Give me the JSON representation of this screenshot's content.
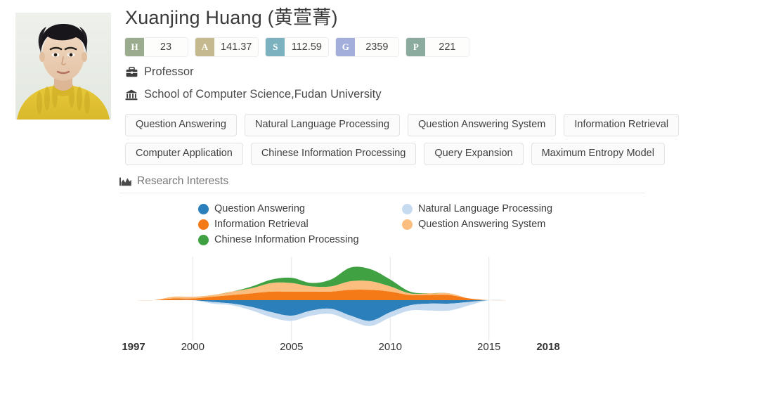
{
  "profile": {
    "photo_alt": "portrait-photo",
    "name": "Xuanjing Huang (黄萱菁)",
    "position": "Professor",
    "position_icon": "briefcase-icon",
    "affiliation": "School of Computer Science,Fudan University",
    "affiliation_icon": "institution-icon"
  },
  "metrics": [
    {
      "key": "H",
      "label": "H",
      "value": "23",
      "color": "#9aab8e"
    },
    {
      "key": "A",
      "label": "A",
      "value": "141.37",
      "color": "#c5b98f"
    },
    {
      "key": "S",
      "label": "S",
      "value": "112.59",
      "color": "#7cb1bf"
    },
    {
      "key": "G",
      "label": "G",
      "value": "2359",
      "color": "#a3aedb"
    },
    {
      "key": "P",
      "label": "P",
      "value": "221",
      "color": "#8aab9e"
    }
  ],
  "tags": [
    "Question Answering",
    "Natural Language Processing",
    "Question Answering System",
    "Information Retrieval",
    "Computer Application",
    "Chinese Information Processing",
    "Query Expansion",
    "Maximum Entropy Model"
  ],
  "research": {
    "section_title": "Research Interests",
    "section_icon": "area-chart-icon"
  },
  "chart_data": {
    "type": "area",
    "title": "Research Interests",
    "xlabel": "",
    "ylabel": "",
    "grid": true,
    "legend_position": "top",
    "xlim": [
      1997,
      2018
    ],
    "x_ticks": [
      1997,
      2000,
      2005,
      2010,
      2015,
      2018
    ],
    "x_ticks_bold": [
      1997,
      2018
    ],
    "x": [
      1997,
      1998,
      1999,
      2000,
      2001,
      2002,
      2003,
      2004,
      2005,
      2006,
      2007,
      2008,
      2009,
      2010,
      2011,
      2012,
      2013,
      2014,
      2015,
      2016,
      2017,
      2018
    ],
    "series": [
      {
        "name": "Question Answering",
        "color": "#2b7fba",
        "values": [
          0,
          0,
          0,
          0,
          1,
          2,
          4,
          7,
          9,
          6,
          5,
          9,
          12,
          7,
          3,
          2,
          2,
          1,
          0,
          0,
          0,
          0
        ]
      },
      {
        "name": "Natural Language Processing",
        "color": "#c6dbef",
        "values": [
          0,
          0,
          0,
          0,
          1,
          1,
          2,
          3,
          3,
          3,
          3,
          3,
          3,
          3,
          3,
          4,
          4,
          2,
          0,
          0,
          0,
          0
        ]
      },
      {
        "name": "Information Retrieval",
        "color": "#f47a17",
        "values": [
          0,
          0,
          1,
          1,
          2,
          3,
          4,
          5,
          5,
          5,
          5,
          6,
          6,
          5,
          3,
          3,
          3,
          1,
          0,
          0,
          0,
          0
        ]
      },
      {
        "name": "Question Answering System",
        "color": "#fbbe7e",
        "values": [
          0,
          0,
          1,
          1,
          1,
          2,
          3,
          5,
          5,
          3,
          3,
          5,
          5,
          3,
          1,
          1,
          1,
          0,
          0,
          0,
          0,
          0
        ]
      },
      {
        "name": "Chinese Information Processing",
        "color": "#3fa142",
        "values": [
          0,
          0,
          0,
          0,
          0,
          0,
          1,
          2,
          3,
          2,
          4,
          8,
          7,
          4,
          1,
          0,
          0,
          0,
          0,
          0,
          0,
          0
        ]
      }
    ]
  }
}
